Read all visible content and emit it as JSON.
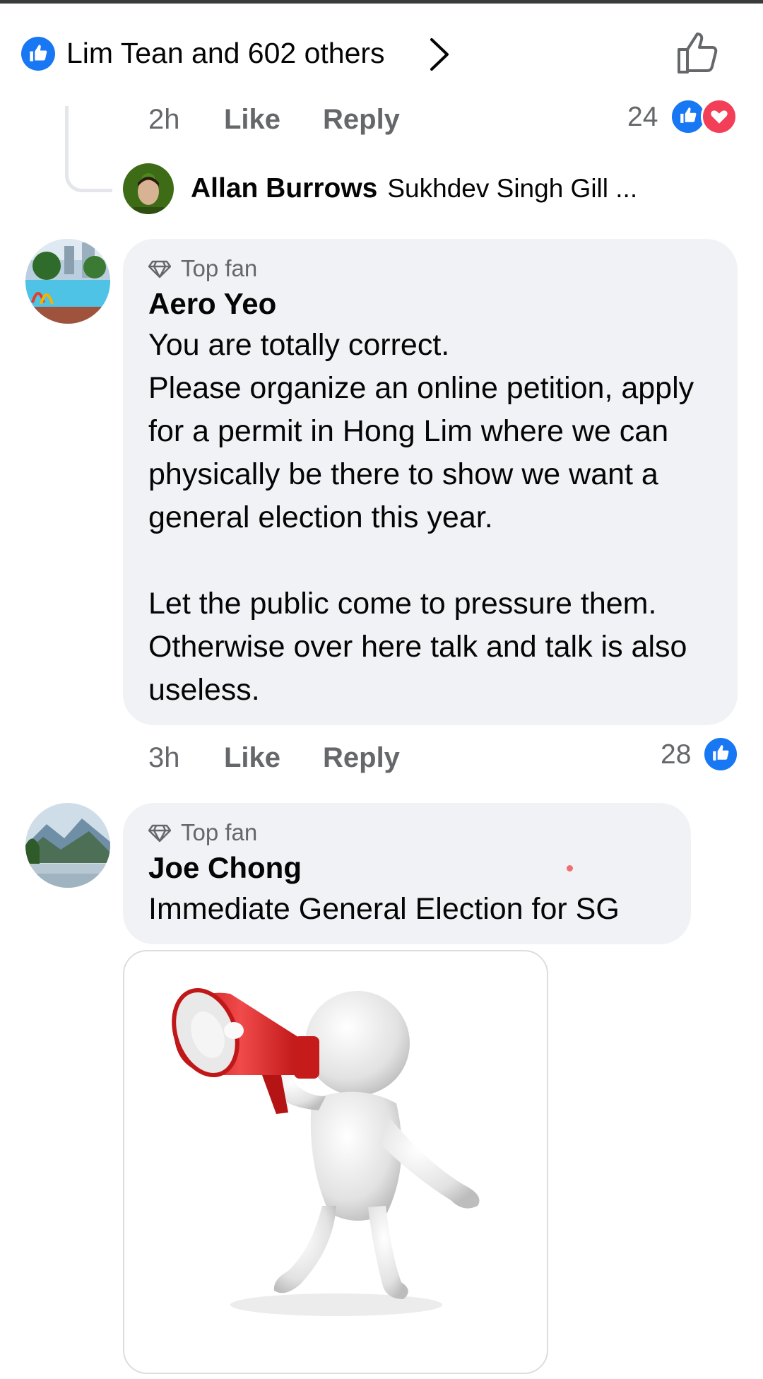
{
  "reactions_header": {
    "text": "Lim Tean and 602 others"
  },
  "thread_reply_meta": {
    "time": "2h",
    "like": "Like",
    "reply": "Reply",
    "reaction_count": "24"
  },
  "collapsed_reply": {
    "author": "Allan Burrows",
    "snippet": "Sukhdev Singh Gill ..."
  },
  "comments": [
    {
      "badge": "Top fan",
      "author": "Aero Yeo",
      "text": "You are totally correct.\nPlease organize an online petition, apply for a permit in Hong Lim where we can physically be there to show we want a general election this year.\n\nLet the public come to pressure them. Otherwise  over here talk and talk is also useless.",
      "time": "3h",
      "like": "Like",
      "reply": "Reply",
      "reaction_count": "28"
    },
    {
      "badge": "Top fan",
      "author": "Joe Chong",
      "text": "Immediate General Election for SG",
      "attachment": "megaphone-figure-image"
    }
  ],
  "colors": {
    "facebook_blue": "#1877f2",
    "love_red": "#f33e58",
    "bubble_gray": "#f0f2f5",
    "meta_gray": "#65676b"
  }
}
